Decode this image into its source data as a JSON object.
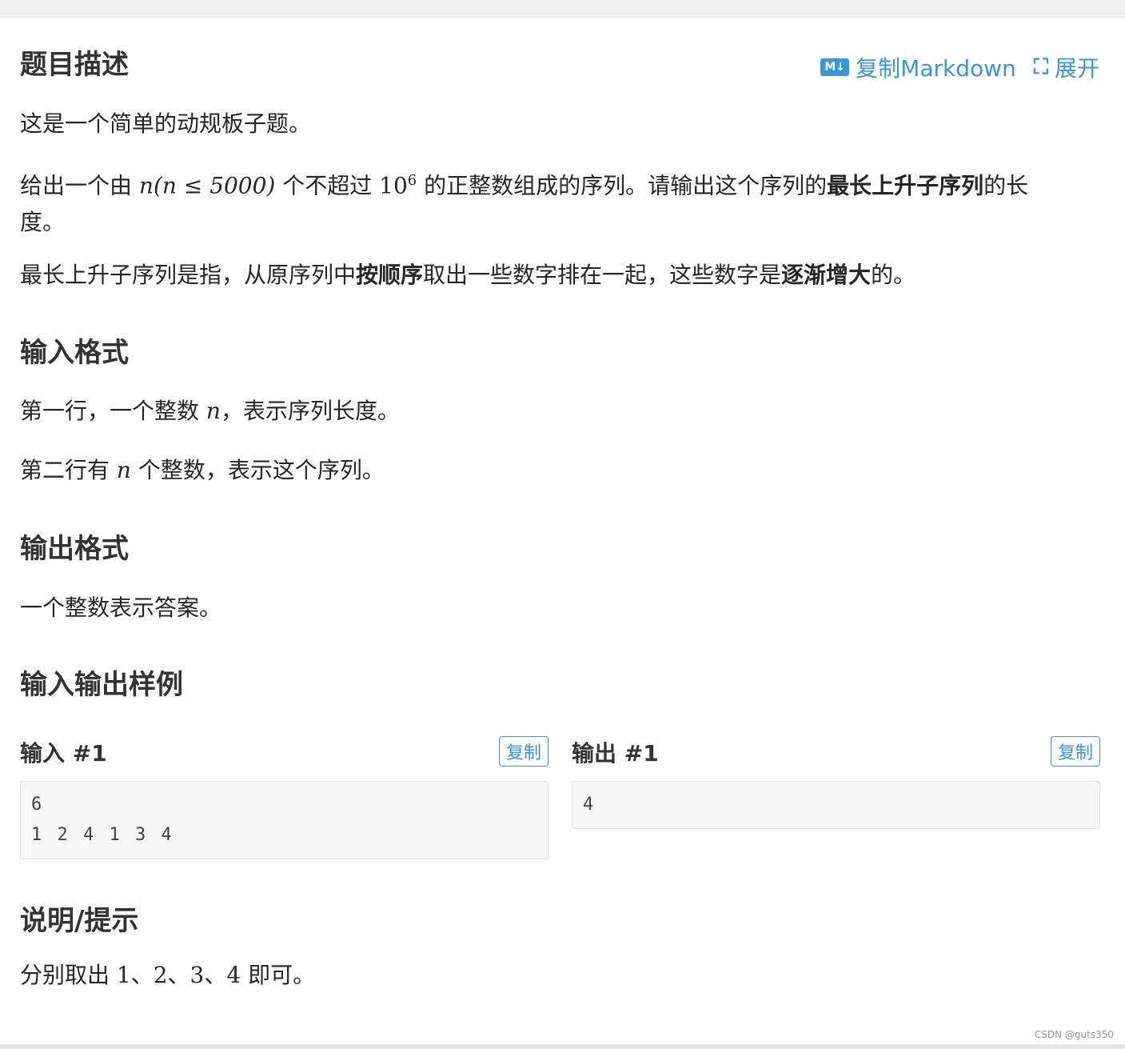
{
  "actions": {
    "copy_markdown": "复制Markdown",
    "expand": "展开",
    "md_badge": "M↓"
  },
  "sections": {
    "description": {
      "title": "题目描述",
      "p1": "这是一个简单的动规板子题。",
      "p2": {
        "a": "给出一个由 ",
        "math1": "n(n ≤ 5000)",
        "b": " 个不超过 ",
        "math2": "10",
        "sup": "6",
        "c": " 的正整数组成的序列。请输出这个序列的",
        "bold": "最长上升子序列",
        "d": "的长度。"
      },
      "p3": {
        "a": "最长上升子序列是指，从原序列中",
        "bold1": "按顺序",
        "b": "取出一些数字排在一起，这些数字是",
        "bold2": "逐渐增大",
        "c": "的。"
      }
    },
    "input_format": {
      "title": "输入格式",
      "l1a": "第一行，一个整数 ",
      "n": "n",
      "l1b": "，表示序列长度。",
      "l2a": "第二行有 ",
      "l2b": " 个整数，表示这个序列。"
    },
    "output_format": {
      "title": "输出格式",
      "text": "一个整数表示答案。"
    },
    "samples": {
      "title": "输入输出样例",
      "input_label": "输入 #1",
      "output_label": "输出 #1",
      "copy": "复制",
      "input_lines": [
        "6",
        "1 2 4 1 3 4"
      ],
      "output_lines": [
        "4"
      ]
    },
    "hint": {
      "title": "说明/提示",
      "a": "分别取出 ",
      "nums": "1、2、3、4",
      "b": " 即可。"
    }
  },
  "watermark": "CSDN @guts350",
  "colors": {
    "accent": "#3498db",
    "text": "#262626"
  }
}
